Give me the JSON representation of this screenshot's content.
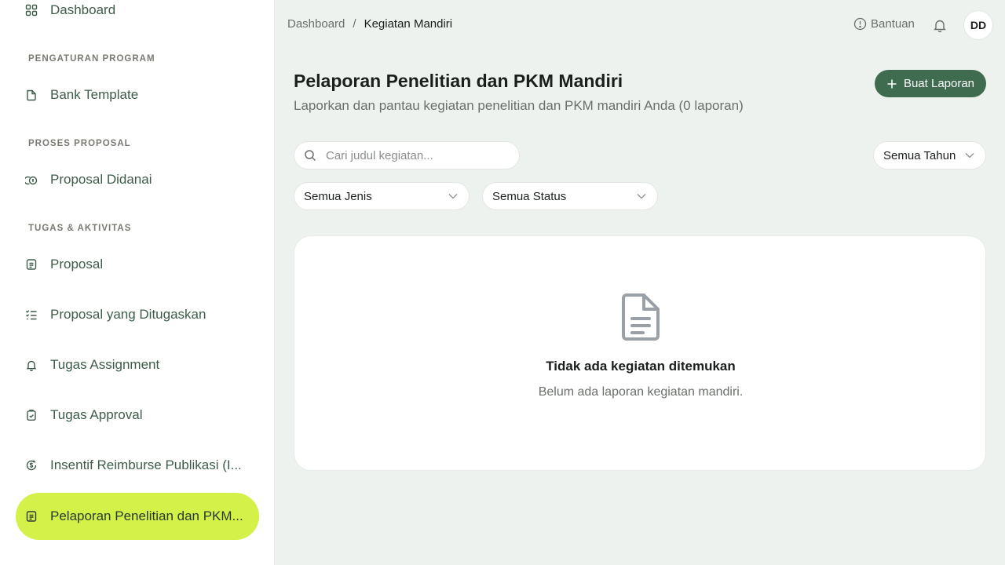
{
  "sidebar": {
    "items": [
      {
        "label": "Dashboard",
        "icon": "grid-icon"
      },
      {
        "label": "Bank Template",
        "icon": "file-icon"
      },
      {
        "label": "Proposal Didanai",
        "icon": "money-icon"
      },
      {
        "label": "Proposal",
        "icon": "document-icon"
      },
      {
        "label": "Proposal yang Ditugaskan",
        "icon": "list-check-icon"
      },
      {
        "label": "Tugas Assignment",
        "icon": "bell-icon"
      },
      {
        "label": "Tugas Approval",
        "icon": "clipboard-check-icon"
      },
      {
        "label": "Insentif Reimburse Publikasi (I...",
        "icon": "dollar-refresh-icon"
      },
      {
        "label": "Pelaporan Penelitian dan PKM...",
        "icon": "report-icon",
        "active": true
      }
    ],
    "sections": {
      "program": "PENGATURAN PROGRAM",
      "proposal": "PROSES PROPOSAL",
      "tasks": "TUGAS & AKTIVITAS"
    }
  },
  "header": {
    "breadcrumb": {
      "root": "Dashboard",
      "separator": "/",
      "current": "Kegiatan Mandiri"
    },
    "help_label": "Bantuan",
    "avatar_initials": "DD"
  },
  "page": {
    "title": "Pelaporan Penelitian dan PKM Mandiri",
    "subtitle": "Laporkan dan pantau kegiatan penelitian dan PKM mandiri Anda (0 laporan)",
    "create_button": "Buat Laporan"
  },
  "filters": {
    "search_placeholder": "Cari judul kegiatan...",
    "year": "Semua Tahun",
    "type": "Semua Jenis",
    "status": "Semua Status"
  },
  "empty_state": {
    "title": "Tidak ada kegiatan ditemukan",
    "message": "Belum ada laporan kegiatan mandiri."
  },
  "colors": {
    "accent": "#d4f14a",
    "primary": "#3f6b4f",
    "sidebar_text": "#3d5c49",
    "background": "#eef2ef"
  }
}
